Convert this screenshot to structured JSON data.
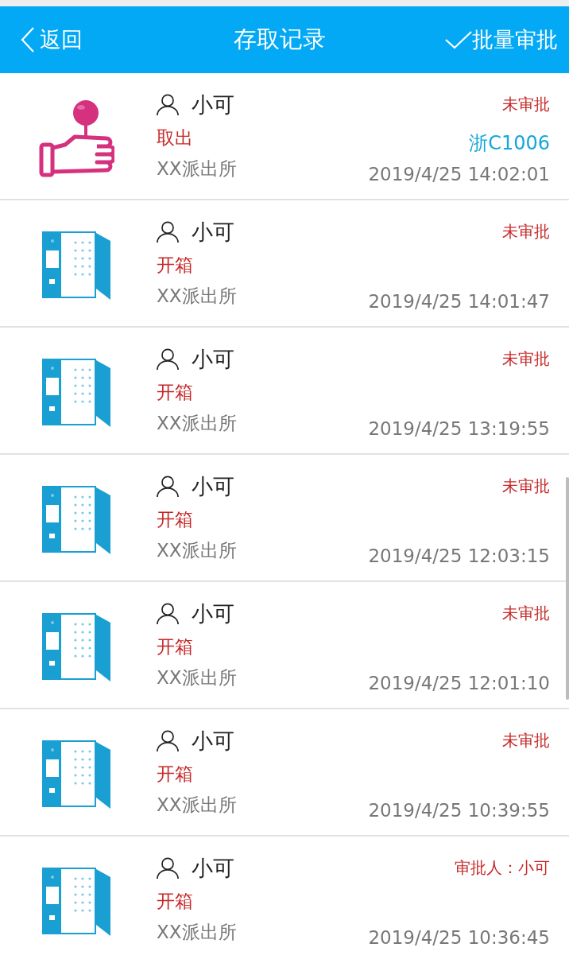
{
  "header": {
    "back": "返回",
    "title": "存取记录",
    "batch": "批量审批"
  },
  "records": [
    {
      "kind": "take",
      "user": "小可",
      "action": "取出",
      "station": "XX派出所",
      "status": "未审批",
      "plate": "浙C1006",
      "time": "2019/4/25 14:02:01"
    },
    {
      "kind": "open",
      "user": "小可",
      "action": "开箱",
      "station": "XX派出所",
      "status": "未审批",
      "time": "2019/4/25 14:01:47"
    },
    {
      "kind": "open",
      "user": "小可",
      "action": "开箱",
      "station": "XX派出所",
      "status": "未审批",
      "time": "2019/4/25 13:19:55"
    },
    {
      "kind": "open",
      "user": "小可",
      "action": "开箱",
      "station": "XX派出所",
      "status": "未审批",
      "time": "2019/4/25 12:03:15"
    },
    {
      "kind": "open",
      "user": "小可",
      "action": "开箱",
      "station": "XX派出所",
      "status": "未审批",
      "time": "2019/4/25 12:01:10"
    },
    {
      "kind": "open",
      "user": "小可",
      "action": "开箱",
      "station": "XX派出所",
      "status": "未审批",
      "time": "2019/4/25 10:39:55"
    },
    {
      "kind": "open",
      "user": "小可",
      "action": "开箱",
      "station": "XX派出所",
      "status": "审批人：小可",
      "time": "2019/4/25 10:36:45"
    }
  ]
}
